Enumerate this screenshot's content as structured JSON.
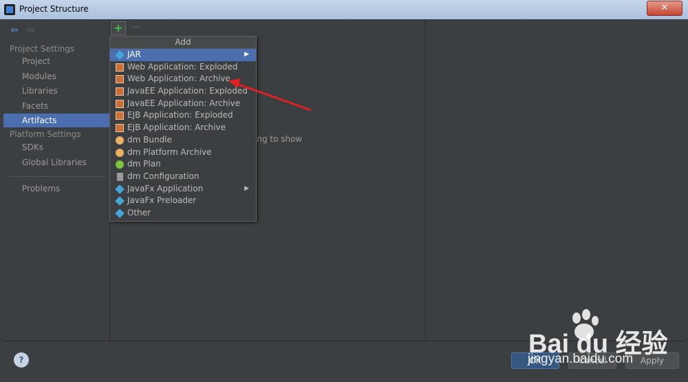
{
  "window": {
    "title": "Project Structure",
    "close_glyph": "✕"
  },
  "nav": {
    "back_icon": "arrow-left-icon",
    "forward_icon": "arrow-right-icon"
  },
  "sidebar": {
    "project_settings_title": "Project Settings",
    "project_settings": [
      {
        "label": "Project"
      },
      {
        "label": "Modules"
      },
      {
        "label": "Libraries"
      },
      {
        "label": "Facets"
      },
      {
        "label": "Artifacts",
        "selected": true
      }
    ],
    "platform_settings_title": "Platform Settings",
    "platform_settings": [
      {
        "label": "SDKs"
      },
      {
        "label": "Global Libraries"
      }
    ],
    "problems": "Problems"
  },
  "toolbar": {
    "add": "+",
    "remove": "—"
  },
  "content": {
    "empty_text": "ing to show"
  },
  "menu": {
    "header": "Add",
    "items": [
      {
        "label": "JAR",
        "icon": "diamond",
        "submenu": true,
        "selected": true
      },
      {
        "label": "Web Application: Exploded",
        "icon": "war"
      },
      {
        "label": "Web Application: Archive",
        "icon": "war"
      },
      {
        "label": "JavaEE Application: Exploded",
        "icon": "war"
      },
      {
        "label": "JavaEE Application: Archive",
        "icon": "war"
      },
      {
        "label": "EJB Application: Exploded",
        "icon": "war"
      },
      {
        "label": "EJB Application: Archive",
        "icon": "war"
      },
      {
        "label": "dm Bundle",
        "icon": "bundle"
      },
      {
        "label": "dm Platform Archive",
        "icon": "bundle"
      },
      {
        "label": "dm Plan",
        "icon": "plan"
      },
      {
        "label": "dm Configuration",
        "icon": "config"
      },
      {
        "label": "JavaFx Application",
        "icon": "diamond",
        "submenu": true
      },
      {
        "label": "JavaFx Preloader",
        "icon": "diamond"
      },
      {
        "label": "Other",
        "icon": "diamond"
      }
    ]
  },
  "buttons": {
    "help": "?",
    "ok": "OK",
    "cancel": "Cancel",
    "apply": "Apply"
  },
  "watermark": {
    "brand": "Bai du 经验",
    "url": "jingyan.baidu.com"
  },
  "colors": {
    "selection": "#4b6eaf",
    "arrow": "#e02020",
    "add_green": "#3fbb3f"
  }
}
